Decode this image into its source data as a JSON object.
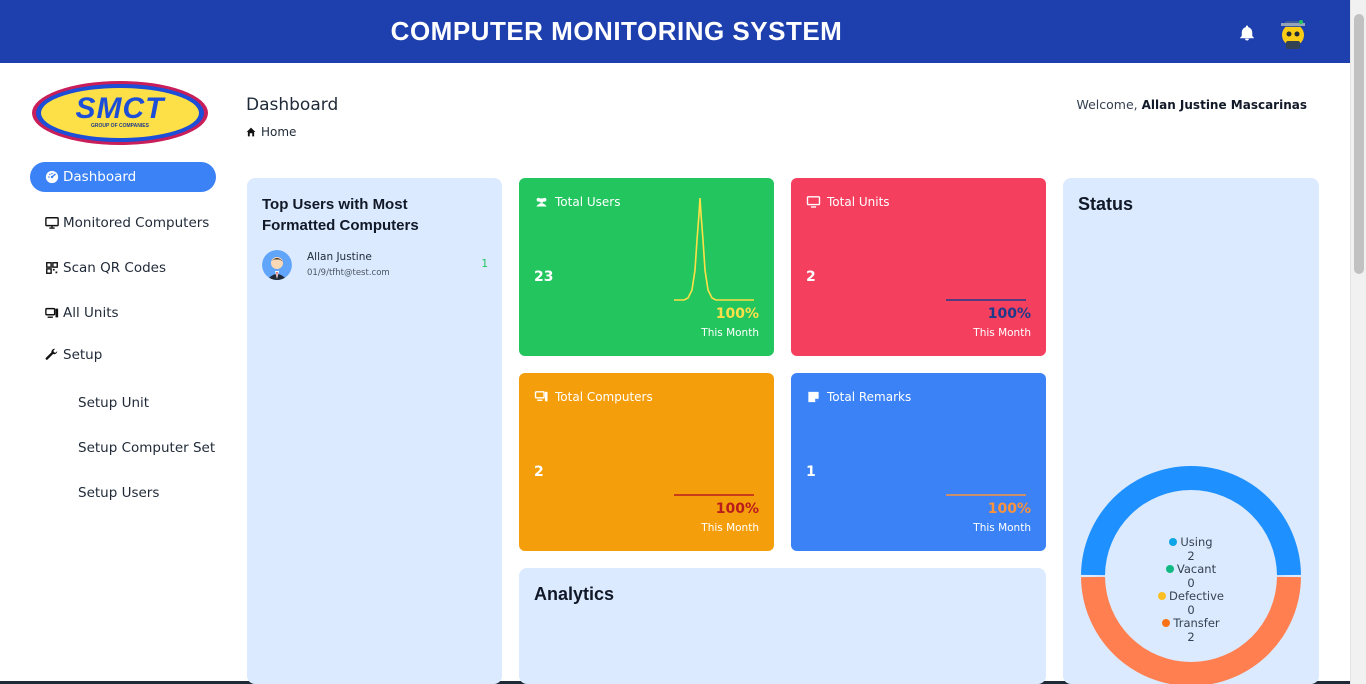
{
  "header": {
    "title": "COMPUTER MONITORING SYSTEM",
    "bell_icon": "bell-icon",
    "avatar_icon": "user-avatar"
  },
  "logo": {
    "text": "SMCT",
    "subtext": "GROUP OF COMPANIES"
  },
  "sidebar": {
    "items": [
      {
        "label": "Dashboard",
        "icon": "dashboard-icon",
        "active": true
      },
      {
        "label": "Monitored Computers",
        "icon": "monitor-icon"
      },
      {
        "label": "Scan QR Codes",
        "icon": "qr-icon"
      },
      {
        "label": "All Units",
        "icon": "units-icon"
      },
      {
        "label": "Setup",
        "icon": "wrench-icon"
      },
      {
        "label": "Setup Unit"
      },
      {
        "label": "Setup Computer Set"
      },
      {
        "label": "Setup Users"
      }
    ]
  },
  "page": {
    "title": "Dashboard",
    "breadcrumb": "Home",
    "welcome_prefix": "Welcome,",
    "welcome_name": "Allan Justine Mascarinas"
  },
  "top_users": {
    "title_line1": "Top Users with Most",
    "title_line2": "Formatted Computers",
    "users": [
      {
        "name": "Allan Justine",
        "email": "01/9/tfht@test.com",
        "count": "1"
      }
    ]
  },
  "cards": [
    {
      "title": "Total Users",
      "value": "23",
      "percent": "100%",
      "period": "This Month",
      "bg": "#22c55e",
      "line": "#fde047",
      "pct_color": "#fde047"
    },
    {
      "title": "Total Units",
      "value": "2",
      "percent": "100%",
      "period": "This Month",
      "bg": "#f43f5e",
      "line": "#1e3a8a",
      "pct_color": "#1e3a8a"
    },
    {
      "title": "Total Computers",
      "value": "2",
      "percent": "100%",
      "period": "This Month",
      "bg": "#f59e0b",
      "line": "#b91c1c",
      "pct_color": "#b91c1c"
    },
    {
      "title": "Total Remarks",
      "value": "1",
      "percent": "100%",
      "period": "This Month",
      "bg": "#3b82f6",
      "line": "#fb923c",
      "pct_color": "#fb923c"
    }
  ],
  "analytics": {
    "title": "Analytics"
  },
  "status": {
    "title": "Status",
    "legend": [
      {
        "label": "Using",
        "value": "2",
        "color": "#0ea5e9"
      },
      {
        "label": "Vacant",
        "value": "0",
        "color": "#10b981"
      },
      {
        "label": "Defective",
        "value": "0",
        "color": "#fbbf24"
      },
      {
        "label": "Transfer",
        "value": "2",
        "color": "#f97316"
      }
    ]
  },
  "chart_data": {
    "type": "pie",
    "categories": [
      "Using",
      "Vacant",
      "Defective",
      "Transfer"
    ],
    "values": [
      2,
      0,
      0,
      2
    ],
    "title": "Status",
    "colors": [
      "#1e90ff",
      "#10b981",
      "#fbbf24",
      "#ff7f50"
    ]
  }
}
